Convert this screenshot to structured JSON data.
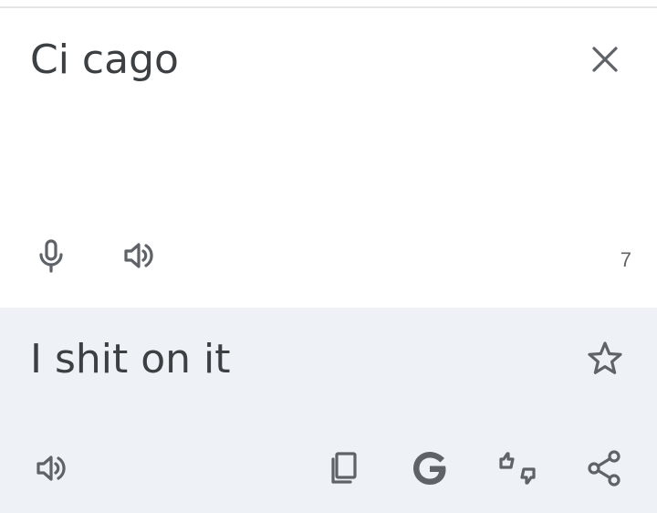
{
  "source": {
    "text": "Ci cago",
    "char_count": "7",
    "icons": {
      "clear": "close-icon",
      "mic": "microphone-icon",
      "speak": "speaker-icon"
    }
  },
  "result": {
    "text": "I shit on it",
    "icons": {
      "star": "star-outline-icon",
      "speak": "speaker-icon",
      "copy": "copy-icon",
      "google": "google-g-icon",
      "feedback": "thumbs-up-down-icon",
      "share": "share-icon"
    }
  },
  "colors": {
    "result_background": "#eef1f6",
    "source_background": "#ffffff",
    "text": "#3c4043",
    "icon": "#5f6368"
  }
}
